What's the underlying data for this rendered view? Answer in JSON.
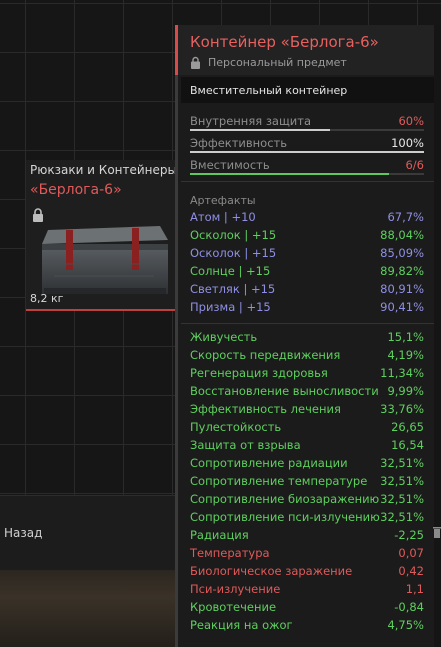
{
  "item_card": {
    "category": "Рюкзаки и Контейнеры",
    "name": "«Берлога-6»",
    "weight": "8,2 кг"
  },
  "bottom": {
    "back_label": "Назад"
  },
  "tooltip": {
    "title": "Контейнер «Берлога-6»",
    "subtitle": "Персональный предмет",
    "type": "Вместительный контейнер",
    "stats": [
      {
        "label": "Внутренняя защита",
        "value": "60%",
        "color": "#e05a5a",
        "fill": 0.6,
        "bar_color": "#cccccc"
      },
      {
        "label": "Эффективность",
        "value": "100%",
        "color": "#e8e8e8",
        "fill": 1.0,
        "bar_color": "#cccccc"
      },
      {
        "label": "Вместимость",
        "value": "6/6",
        "color": "#e05a5a",
        "fill": 0.85,
        "bar_color": "#5fc75f"
      }
    ],
    "artifacts_title": "Артефакты",
    "artifacts": [
      {
        "label": "Атом | +10",
        "value": "67,7%",
        "color": "#8f8fe6"
      },
      {
        "label": "Осколок | +15",
        "value": "88,04%",
        "color": "#5ed05e"
      },
      {
        "label": "Осколок | +15",
        "value": "85,09%",
        "color": "#8f8fe6"
      },
      {
        "label": "Солнце | +15",
        "value": "89,82%",
        "color": "#5ed05e"
      },
      {
        "label": "Светляк | +15",
        "value": "80,91%",
        "color": "#8f8fe6"
      },
      {
        "label": "Призма | +15",
        "value": "90,41%",
        "color": "#8f8fe6"
      }
    ],
    "effects": [
      {
        "label": "Живучесть",
        "value": "15,1%",
        "color": "#5ed05e"
      },
      {
        "label": "Скорость передвижения",
        "value": "4,19%",
        "color": "#5ed05e"
      },
      {
        "label": "Регенерация здоровья",
        "value": "11,34%",
        "color": "#5ed05e"
      },
      {
        "label": "Восстановление выносливости",
        "value": "9,99%",
        "color": "#5ed05e"
      },
      {
        "label": "Эффективность лечения",
        "value": "33,76%",
        "color": "#5ed05e"
      },
      {
        "label": "Пулестойкость",
        "value": "26,65",
        "color": "#5ed05e"
      },
      {
        "label": "Защита от взрыва",
        "value": "16,54",
        "color": "#5ed05e"
      },
      {
        "label": "Сопротивление радиации",
        "value": "32,51%",
        "color": "#5ed05e"
      },
      {
        "label": "Сопротивление температуре",
        "value": "32,51%",
        "color": "#5ed05e"
      },
      {
        "label": "Сопротивление биозаражению",
        "value": "32,51%",
        "color": "#5ed05e"
      },
      {
        "label": "Сопротивление пси-излучению",
        "value": "32,51%",
        "color": "#5ed05e"
      },
      {
        "label": "Радиация",
        "value": "-2,25",
        "color": "#5ed05e"
      },
      {
        "label": "Температура",
        "value": "0,07",
        "color": "#e05a5a"
      },
      {
        "label": "Биологическое заражение",
        "value": "0,42",
        "color": "#e05a5a"
      },
      {
        "label": "Пси-излучение",
        "value": "1,1",
        "color": "#e05a5a"
      },
      {
        "label": "Кровотечение",
        "value": "-0,84",
        "color": "#5ed05e"
      },
      {
        "label": "Реакция на ожог",
        "value": "4,75%",
        "color": "#5ed05e"
      }
    ]
  }
}
